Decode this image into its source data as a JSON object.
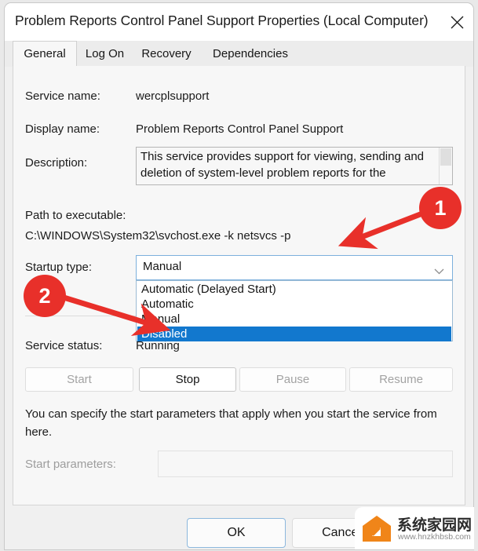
{
  "window": {
    "title": "Problem Reports Control Panel Support Properties (Local Computer)",
    "close_icon": "close-icon"
  },
  "tabs": [
    {
      "label": "General",
      "active": true
    },
    {
      "label": "Log On",
      "active": false
    },
    {
      "label": "Recovery",
      "active": false
    },
    {
      "label": "Dependencies",
      "active": false
    }
  ],
  "general": {
    "service_name_label": "Service name:",
    "service_name_value": "wercplsupport",
    "display_name_label": "Display name:",
    "display_name_value": "Problem Reports Control Panel Support",
    "description_label": "Description:",
    "description_value": "This service provides support for viewing, sending and deletion of system-level problem reports for the Problem Reports control panel.",
    "path_label": "Path to executable:",
    "path_value": "C:\\WINDOWS\\System32\\svchost.exe -k netsvcs -p",
    "startup_type_label": "Startup type:",
    "startup_type_value": "Manual",
    "startup_type_options": [
      "Automatic (Delayed Start)",
      "Automatic",
      "Manual",
      "Disabled"
    ],
    "startup_type_selected": "Disabled",
    "service_status_label": "Service status:",
    "service_status_value": "Running",
    "buttons": [
      {
        "label": "Start",
        "enabled": false
      },
      {
        "label": "Stop",
        "enabled": true
      },
      {
        "label": "Pause",
        "enabled": false
      },
      {
        "label": "Resume",
        "enabled": false
      }
    ],
    "hint_text": "You can specify the start parameters that apply when you start the service from here.",
    "start_parameters_label": "Start parameters:",
    "start_parameters_value": ""
  },
  "footer": {
    "ok_label": "OK",
    "cancel_label": "Cancel"
  },
  "annotations": [
    {
      "number": "1"
    },
    {
      "number": "2"
    }
  ],
  "watermark": {
    "name": "系统家园网",
    "url": "www.hnzkhbsb.com"
  },
  "colors": {
    "accent_blue": "#1278ce",
    "annotation_red": "#e8302a",
    "watermark_orange": "#f08519"
  }
}
